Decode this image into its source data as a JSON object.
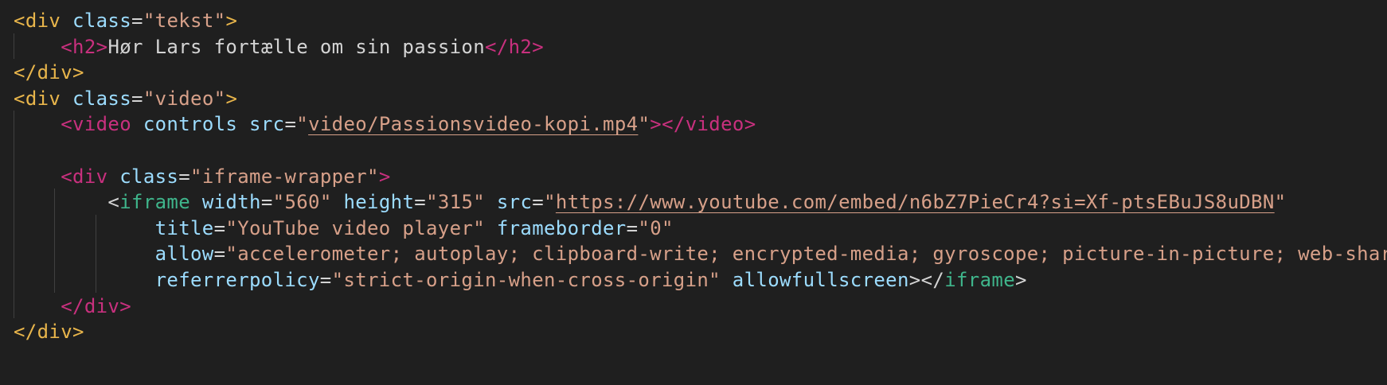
{
  "theme": {
    "background": "#1f1f1f",
    "text": "#d4d4d4",
    "tag_gold": "#e8b54b",
    "tag_pink": "#c8307e",
    "tag_green": "#3fb58b",
    "attribute": "#9cdcfe",
    "string": "#d7a089",
    "indent_guide": "#404040"
  },
  "lines": [
    {
      "tokens": [
        {
          "t": "<",
          "c": "bracket-gold"
        },
        {
          "t": "div",
          "c": "tag-gold"
        },
        {
          "t": " ",
          "c": "text"
        },
        {
          "t": "class",
          "c": "attr"
        },
        {
          "t": "=",
          "c": "eq"
        },
        {
          "t": "\"tekst\"",
          "c": "str"
        },
        {
          "t": ">",
          "c": "bracket-gold"
        }
      ]
    },
    {
      "tokens": [
        {
          "t": "    ",
          "c": "text"
        },
        {
          "t": "<",
          "c": "bracket-pink"
        },
        {
          "t": "h2",
          "c": "tag-pink"
        },
        {
          "t": ">",
          "c": "bracket-pink"
        },
        {
          "t": "Hør Lars fortælle om sin passion",
          "c": "text"
        },
        {
          "t": "</",
          "c": "bracket-pink"
        },
        {
          "t": "h2",
          "c": "tag-pink"
        },
        {
          "t": ">",
          "c": "bracket-pink"
        }
      ]
    },
    {
      "tokens": [
        {
          "t": "</",
          "c": "bracket-gold"
        },
        {
          "t": "div",
          "c": "tag-gold"
        },
        {
          "t": ">",
          "c": "bracket-gold"
        }
      ]
    },
    {
      "tokens": [
        {
          "t": "<",
          "c": "bracket-gold"
        },
        {
          "t": "div",
          "c": "tag-gold"
        },
        {
          "t": " ",
          "c": "text"
        },
        {
          "t": "class",
          "c": "attr"
        },
        {
          "t": "=",
          "c": "eq"
        },
        {
          "t": "\"video\"",
          "c": "str"
        },
        {
          "t": ">",
          "c": "bracket-gold"
        }
      ]
    },
    {
      "tokens": [
        {
          "t": "    ",
          "c": "text"
        },
        {
          "t": "<",
          "c": "bracket-pink"
        },
        {
          "t": "video",
          "c": "tag-pink"
        },
        {
          "t": " ",
          "c": "text"
        },
        {
          "t": "controls",
          "c": "attr"
        },
        {
          "t": " ",
          "c": "text"
        },
        {
          "t": "src",
          "c": "attr"
        },
        {
          "t": "=",
          "c": "eq"
        },
        {
          "t": "\"",
          "c": "str"
        },
        {
          "t": "video/Passionsvideo-kopi.mp4",
          "c": "url"
        },
        {
          "t": "\"",
          "c": "str"
        },
        {
          "t": "></",
          "c": "bracket-pink"
        },
        {
          "t": "video",
          "c": "tag-pink"
        },
        {
          "t": ">",
          "c": "bracket-pink"
        }
      ]
    },
    {
      "tokens": []
    },
    {
      "tokens": [
        {
          "t": "    ",
          "c": "text"
        },
        {
          "t": "<",
          "c": "bracket-pink"
        },
        {
          "t": "div",
          "c": "tag-pink"
        },
        {
          "t": " ",
          "c": "text"
        },
        {
          "t": "class",
          "c": "attr"
        },
        {
          "t": "=",
          "c": "eq"
        },
        {
          "t": "\"iframe-wrapper\"",
          "c": "str"
        },
        {
          "t": ">",
          "c": "bracket-pink"
        }
      ]
    },
    {
      "tokens": [
        {
          "t": "        ",
          "c": "text"
        },
        {
          "t": "<",
          "c": "bracket-green"
        },
        {
          "t": "iframe",
          "c": "tag-green"
        },
        {
          "t": " ",
          "c": "text"
        },
        {
          "t": "width",
          "c": "attr"
        },
        {
          "t": "=",
          "c": "eq"
        },
        {
          "t": "\"560\"",
          "c": "str"
        },
        {
          "t": " ",
          "c": "text"
        },
        {
          "t": "height",
          "c": "attr"
        },
        {
          "t": "=",
          "c": "eq"
        },
        {
          "t": "\"315\"",
          "c": "str"
        },
        {
          "t": " ",
          "c": "text"
        },
        {
          "t": "src",
          "c": "attr"
        },
        {
          "t": "=",
          "c": "eq"
        },
        {
          "t": "\"",
          "c": "str"
        },
        {
          "t": "https://www.youtube.com/embed/n6bZ7PieCr4?si=Xf-ptsEBuJS8uDBN",
          "c": "url"
        },
        {
          "t": "\"",
          "c": "str"
        }
      ]
    },
    {
      "tokens": [
        {
          "t": "            ",
          "c": "text"
        },
        {
          "t": "title",
          "c": "attr"
        },
        {
          "t": "=",
          "c": "eq"
        },
        {
          "t": "\"YouTube video player\"",
          "c": "str"
        },
        {
          "t": " ",
          "c": "text"
        },
        {
          "t": "frameborder",
          "c": "attr"
        },
        {
          "t": "=",
          "c": "eq"
        },
        {
          "t": "\"0\"",
          "c": "str"
        }
      ]
    },
    {
      "tokens": [
        {
          "t": "            ",
          "c": "text"
        },
        {
          "t": "allow",
          "c": "attr"
        },
        {
          "t": "=",
          "c": "eq"
        },
        {
          "t": "\"accelerometer; autoplay; clipboard-write; encrypted-media; gyroscope; picture-in-picture; web-share\"",
          "c": "str"
        }
      ]
    },
    {
      "tokens": [
        {
          "t": "            ",
          "c": "text"
        },
        {
          "t": "referrerpolicy",
          "c": "attr"
        },
        {
          "t": "=",
          "c": "eq"
        },
        {
          "t": "\"strict-origin-when-cross-origin\"",
          "c": "str"
        },
        {
          "t": " ",
          "c": "text"
        },
        {
          "t": "allowfullscreen",
          "c": "attr"
        },
        {
          "t": "></",
          "c": "bracket-green"
        },
        {
          "t": "iframe",
          "c": "tag-green"
        },
        {
          "t": ">",
          "c": "bracket-green"
        }
      ]
    },
    {
      "tokens": [
        {
          "t": "    ",
          "c": "text"
        },
        {
          "t": "</",
          "c": "bracket-pink"
        },
        {
          "t": "div",
          "c": "tag-pink"
        },
        {
          "t": ">",
          "c": "bracket-pink"
        }
      ]
    },
    {
      "tokens": [
        {
          "t": "</",
          "c": "bracket-gold"
        },
        {
          "t": "div",
          "c": "tag-gold"
        },
        {
          "t": ">",
          "c": "bracket-gold"
        }
      ]
    }
  ]
}
